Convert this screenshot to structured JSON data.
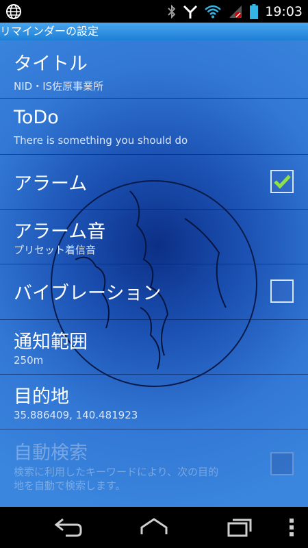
{
  "status_bar": {
    "time": "19:03",
    "icons": [
      "globe-icon",
      "bluetooth-icon",
      "signal-y-icon",
      "wifi-icon",
      "no-sim-icon",
      "battery-icon"
    ]
  },
  "app": {
    "title": "リマインダーの設定"
  },
  "preferences": [
    {
      "title": "タイトル",
      "summary": "NID・IS佐原事業所"
    },
    {
      "title": "ToDo",
      "summary": "There is something you should do"
    },
    {
      "title": "アラーム",
      "checked": true
    },
    {
      "title": "アラーム音",
      "summary": "プリセット着信音"
    },
    {
      "title": "バイブレーション",
      "checked": false
    },
    {
      "title": "通知範囲",
      "summary": "250m"
    },
    {
      "title": "目的地",
      "summary": "35.886409, 140.481923"
    },
    {
      "title": "自動検索",
      "summary_line1": "検索に利用したキーワードにより、次の目的",
      "summary_line2": "地を自動で検索します。",
      "checked": false,
      "enabled": false
    }
  ],
  "nav_bar": {
    "buttons": [
      "back-icon",
      "home-icon",
      "recent-apps-icon",
      "menu-icon"
    ]
  },
  "colors": {
    "accent": "#1d7fd6",
    "check": "#8fe04a"
  }
}
